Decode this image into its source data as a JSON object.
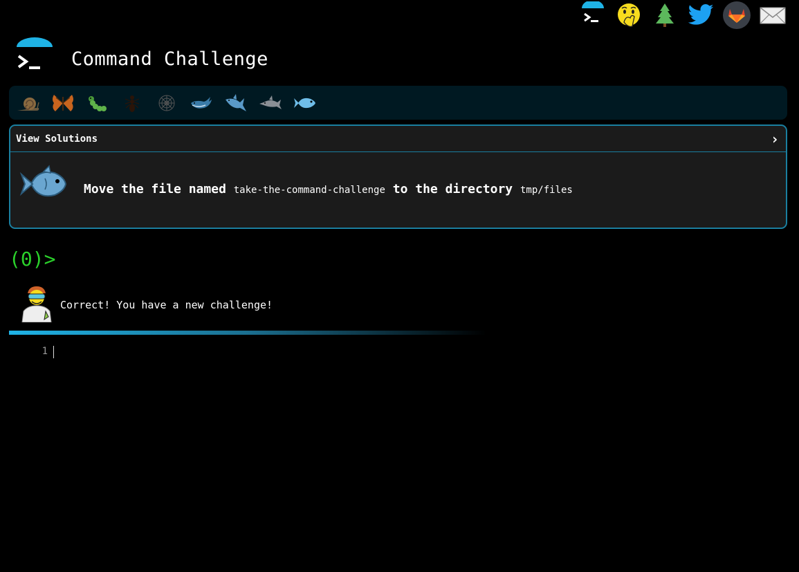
{
  "app": {
    "title": "Command Challenge"
  },
  "top_icons": [
    {
      "name": "terminal-logo-icon"
    },
    {
      "name": "shushing-face-icon"
    },
    {
      "name": "pine-tree-icon"
    },
    {
      "name": "twitter-icon"
    },
    {
      "name": "gitlab-icon"
    },
    {
      "name": "mail-icon"
    }
  ],
  "levels": [
    "snail",
    "butterfly",
    "caterpillar",
    "ant",
    "spiderweb",
    "whale",
    "shark",
    "dolphin",
    "fish"
  ],
  "card": {
    "header_label": "View Solutions",
    "chevron": "›",
    "task_prefix": "Move the file named",
    "task_file": "take-the-command-challenge",
    "task_middle": "to the directory",
    "task_dir": "tmp/files"
  },
  "prompt": {
    "text": "(0)>"
  },
  "feedback": {
    "text": "Correct! You have a new challenge!"
  },
  "editor": {
    "line_number": "1"
  },
  "colors": {
    "accent": "#1fb3e6",
    "prompt": "#2bd12b",
    "card_bg": "#1b1b1b",
    "level_bar_bg": "#001922"
  }
}
